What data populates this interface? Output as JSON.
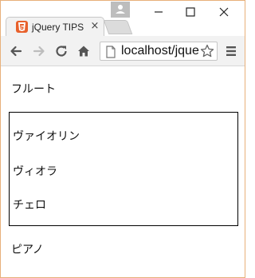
{
  "browser": {
    "tab_title": "jQuery TIPS",
    "tab_close_glyph": "×",
    "address": "localhost/jque"
  },
  "icons": {
    "favicon": "html5-favicon-icon",
    "back": "arrow-left-icon",
    "forward": "arrow-right-icon",
    "reload": "reload-icon",
    "home": "home-icon",
    "page": "page-icon",
    "bookmark": "star-icon",
    "menu": "hamburger-menu-icon",
    "profile": "person-icon"
  },
  "page": {
    "items_before": [
      "フルート"
    ],
    "box_items": [
      "ヴァイオリン",
      "ヴィオラ",
      "チェロ"
    ],
    "items_after": [
      "ピアノ"
    ]
  },
  "colors": {
    "window_border": "#e8b07a",
    "favicon_bg": "#e8612c",
    "toolbar_bg": "#f2f2f2"
  }
}
